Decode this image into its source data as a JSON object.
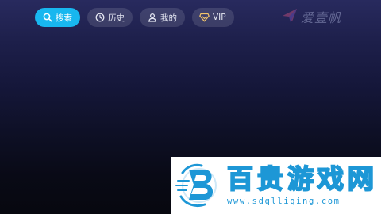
{
  "nav": {
    "items": [
      {
        "label": "搜索",
        "icon": "search-icon",
        "active": true
      },
      {
        "label": "历史",
        "icon": "clock-icon",
        "active": false
      },
      {
        "label": "我的",
        "icon": "user-icon",
        "active": false
      },
      {
        "label": "VIP",
        "icon": "diamond-icon",
        "active": false
      }
    ]
  },
  "brand": {
    "name": "爱壹帆",
    "icon": "paper-plane-logo-icon"
  },
  "watermark": {
    "title": "百贵游戏网",
    "url": "www.sdqlliqing.com",
    "icon": "b-logo-icon"
  },
  "colors": {
    "accent": "#18b7ef",
    "watermark_blue": "#1d97d6"
  }
}
